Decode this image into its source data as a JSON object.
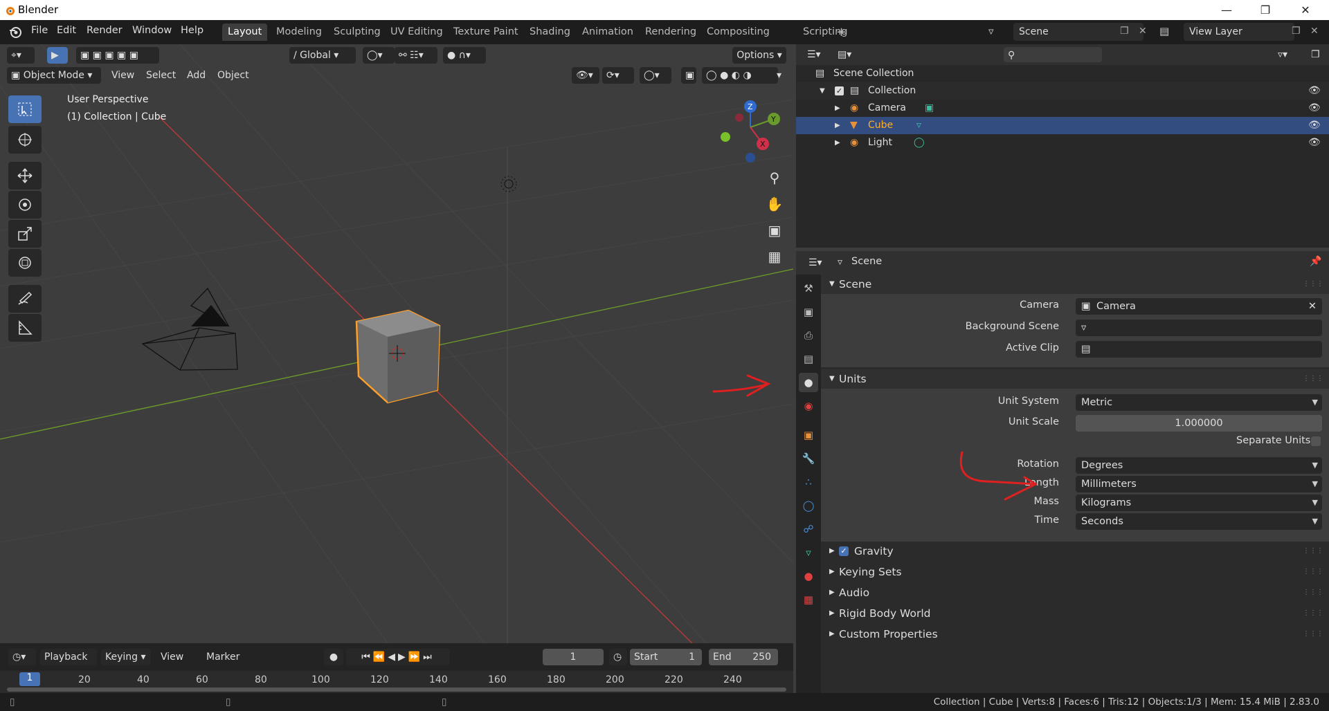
{
  "window": {
    "title": "Blender"
  },
  "menu": [
    "File",
    "Edit",
    "Render",
    "Window",
    "Help"
  ],
  "workspaces": [
    "Layout",
    "Modeling",
    "Sculpting",
    "UV Editing",
    "Texture Paint",
    "Shading",
    "Animation",
    "Rendering",
    "Compositing",
    "Scripting"
  ],
  "scene_selector": "Scene",
  "view_layer_selector": "View Layer",
  "viewport": {
    "transform_orientation": "Global",
    "options_label": "Options",
    "mode": "Object Mode",
    "header_menus": [
      "View",
      "Select",
      "Add",
      "Object"
    ],
    "perspective_label": "User Perspective",
    "collection_label": "(1) Collection | Cube",
    "gizmo_axes": [
      "Z",
      "Y",
      "X"
    ]
  },
  "timeline": {
    "menus": [
      "Playback",
      "Keying",
      "View",
      "Marker"
    ],
    "current_frame": "1",
    "start_label": "Start",
    "start_value": "1",
    "end_label": "End",
    "end_value": "250",
    "ruler_current": "1",
    "ruler_ticks": [
      "20",
      "40",
      "60",
      "80",
      "100",
      "120",
      "140",
      "160",
      "180",
      "200",
      "220",
      "240"
    ]
  },
  "outliner": {
    "root": "Scene Collection",
    "collection": "Collection",
    "items": [
      "Camera",
      "Cube",
      "Light"
    ],
    "selected": "Cube"
  },
  "properties": {
    "context": "Scene",
    "scene_panel": {
      "title": "Scene",
      "camera_label": "Camera",
      "camera_value": "Camera",
      "background_label": "Background Scene",
      "clip_label": "Active Clip"
    },
    "units_panel": {
      "title": "Units",
      "unit_system_label": "Unit System",
      "unit_system_value": "Metric",
      "unit_scale_label": "Unit Scale",
      "unit_scale_value": "1.000000",
      "separate_units_label": "Separate Units",
      "rotation_label": "Rotation",
      "rotation_value": "Degrees",
      "length_label": "Length",
      "length_value": "Millimeters",
      "mass_label": "Mass",
      "mass_value": "Kilograms",
      "time_label": "Time",
      "time_value": "Seconds"
    },
    "collapsed_panels": [
      "Gravity",
      "Keying Sets",
      "Audio",
      "Rigid Body World",
      "Custom Properties"
    ]
  },
  "statusbar": {
    "text": "Collection | Cube | Verts:8 | Faces:6 | Tris:12 | Objects:1/3 | Mem: 15.4 MiB | 2.83.0"
  },
  "colors": {
    "selection": "#334d80",
    "accent": "#4772b3",
    "active_object": "#ffa028",
    "annotation": "#e02020"
  }
}
